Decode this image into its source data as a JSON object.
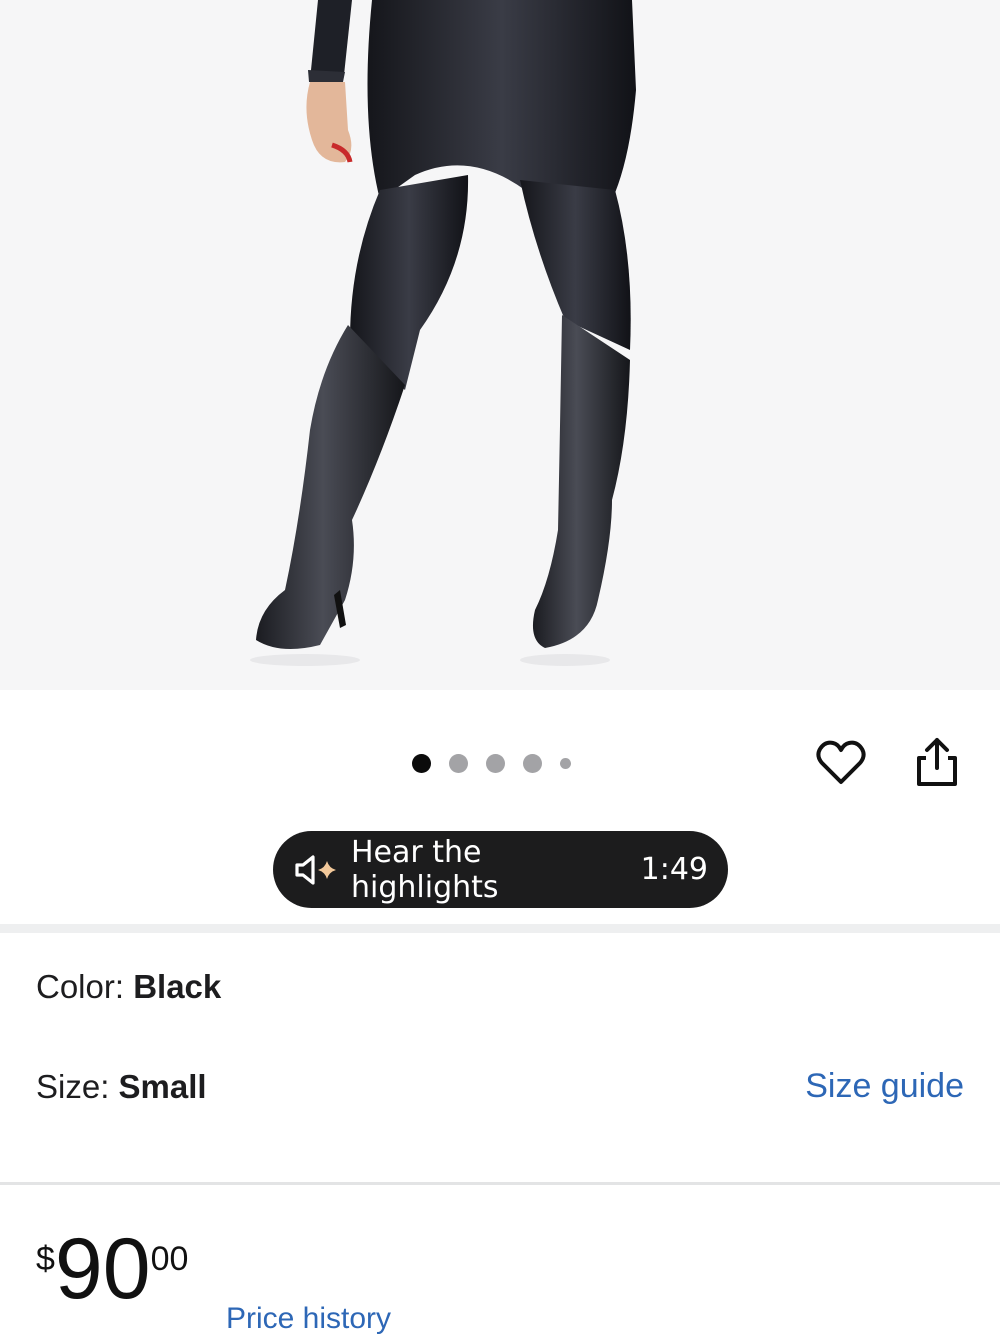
{
  "carousel": {
    "image_count": 5,
    "active_index": 0
  },
  "actions": {
    "favorite_icon": "heart-outline-icon",
    "share_icon": "share-icon"
  },
  "audio": {
    "label": "Hear the highlights",
    "duration": "1:49",
    "icon": "speaker-sparkle-icon"
  },
  "variants": {
    "color_label": "Color:",
    "color_value": "Black",
    "size_label": "Size:",
    "size_value": "Small",
    "size_guide": "Size guide"
  },
  "price": {
    "currency": "$",
    "dollars": "90",
    "cents": "00"
  },
  "price_history": "Price history",
  "colors": {
    "link": "#2d67b6",
    "pill_bg": "#1c1c1d",
    "active_dot": "#0b0b0b",
    "inactive_dot": "#a3a3a6"
  }
}
